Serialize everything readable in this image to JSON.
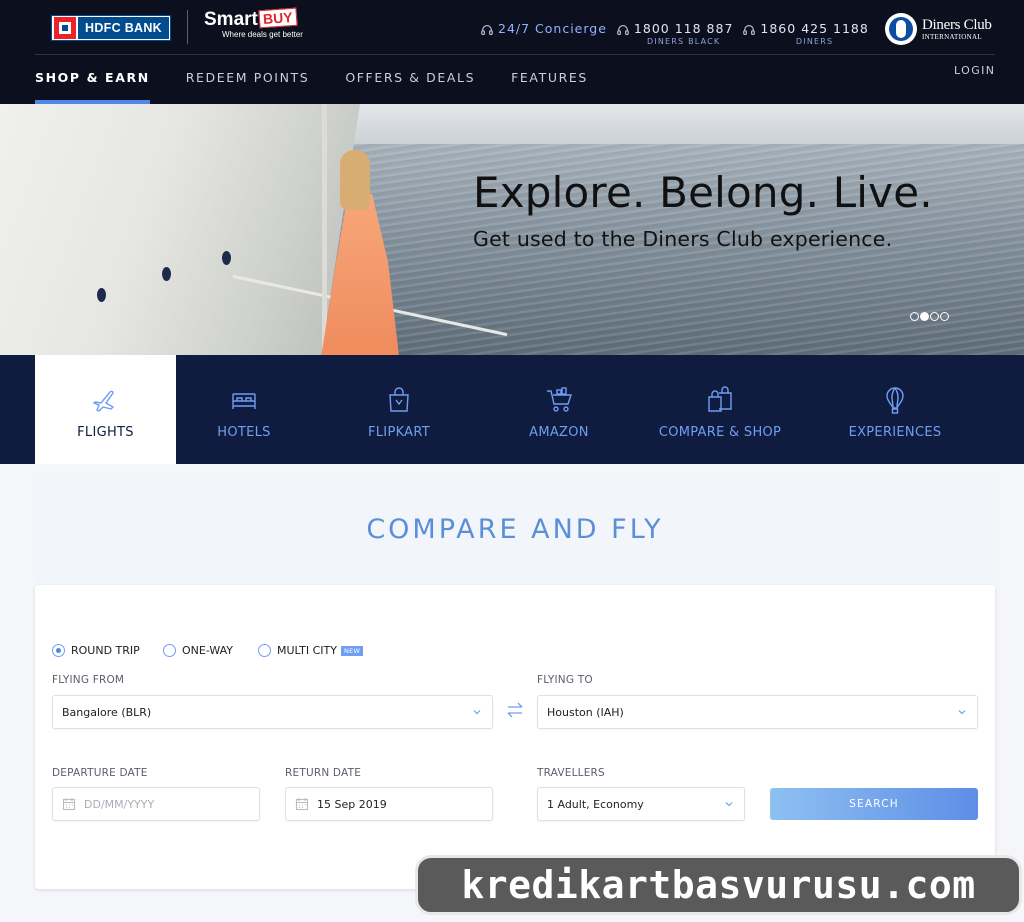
{
  "brand": {
    "hdfc_logo": "HDFC BANK",
    "smartbuy_name": "Smart",
    "smartbuy_buy": "BUY",
    "smartbuy_tagline": "Where deals get better",
    "diners_line1": "Diners Club",
    "diners_line2": "INTERNATIONAL"
  },
  "contacts": [
    {
      "icon": "headset-icon",
      "value": "24/7 Concierge",
      "sub": ""
    },
    {
      "icon": "headset-icon",
      "value": "1800 118 887",
      "sub": "DINERS BLACK"
    },
    {
      "icon": "headset-icon",
      "value": "1860 425 1188",
      "sub": "DINERS"
    }
  ],
  "nav": {
    "items": [
      "SHOP & EARN",
      "REDEEM POINTS",
      "OFFERS & DEALS",
      "FEATURES"
    ],
    "active_index": 0,
    "login": "LOGIN"
  },
  "banner": {
    "title": "Explore. Belong. Live.",
    "subtitle": "Get used to the Diners Club experience.",
    "slides": 4,
    "active_slide": 1
  },
  "categories": [
    {
      "label": "FLIGHTS",
      "icon": "plane-icon",
      "active": true
    },
    {
      "label": "HOTELS",
      "icon": "bed-icon",
      "active": false
    },
    {
      "label": "FLIPKART",
      "icon": "shopping-bag-icon",
      "active": false
    },
    {
      "label": "AMAZON",
      "icon": "cart-icon",
      "active": false
    },
    {
      "label": "COMPARE & SHOP",
      "icon": "compare-bags-icon",
      "active": false
    },
    {
      "label": "EXPERIENCES",
      "icon": "hot-air-balloon-icon",
      "active": false
    }
  ],
  "compare": {
    "title": "COMPARE AND FLY"
  },
  "form": {
    "trip_types": [
      "ROUND TRIP",
      "ONE-WAY",
      "MULTI CITY"
    ],
    "selected_trip": "ROUND TRIP",
    "new_badge": "NEW",
    "flying_from_label": "FLYING FROM",
    "flying_from_value": "Bangalore (BLR)",
    "flying_to_label": "FLYING TO",
    "flying_to_value": "Houston (IAH)",
    "departure_label": "DEPARTURE DATE",
    "departure_placeholder": "DD/MM/YYYY",
    "return_label": "RETURN DATE",
    "return_value": "15 Sep 2019",
    "travellers_label": "TRAVELLERS",
    "travellers_value": "1 Adult, Economy",
    "search_label": "SEARCH"
  },
  "watermark": "kredikartbasvurusu.com",
  "colors": {
    "header_bg": "#0b0f1e",
    "accent": "#4f86e8",
    "category_bg": "#101c3f",
    "category_text": "#6f9ef2"
  }
}
